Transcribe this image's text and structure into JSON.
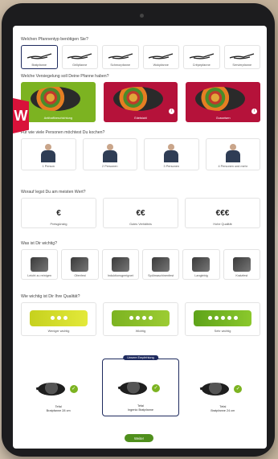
{
  "badge": {
    "text": "W"
  },
  "q1": {
    "title": "Welchen Pfannentyp benötigen Sie?",
    "options": [
      {
        "label": "Bratpfanne",
        "selected": true
      },
      {
        "label": "Grillpfanne",
        "selected": false
      },
      {
        "label": "Schmorpfanne",
        "selected": false
      },
      {
        "label": "Wokpfanne",
        "selected": false
      },
      {
        "label": "Crêpepfanne",
        "selected": false
      },
      {
        "label": "Servierpfanne",
        "selected": false
      }
    ]
  },
  "q2": {
    "title": "Welche Versiegelung soll Deine Pfanne haben?",
    "options": [
      {
        "label": "Antihaftbeschichtung",
        "color": "#7cb321"
      },
      {
        "label": "Edelstahl",
        "color": "#b5123a"
      },
      {
        "label": "Gusseisen",
        "color": "#b5123a"
      }
    ]
  },
  "q3": {
    "title": "Für wie viele Personen möchtest Du kochen?",
    "options": [
      {
        "label": "1 Person"
      },
      {
        "label": "2 Personen"
      },
      {
        "label": "3 Personen"
      },
      {
        "label": "4 Personen und mehr"
      }
    ]
  },
  "q4": {
    "title": "Worauf legst Du am meisten Wert?",
    "options": [
      {
        "symbol": "€",
        "label": "Preisgünstig"
      },
      {
        "symbol": "€€",
        "label": "Gutes Verhältnis"
      },
      {
        "symbol": "€€€",
        "label": "Hohe Qualität"
      }
    ]
  },
  "q5": {
    "title": "Was ist Dir wichtig?",
    "options": [
      {
        "label": "Leicht zu reinigen"
      },
      {
        "label": "Ofenfest"
      },
      {
        "label": "Induktionsgeeignet"
      },
      {
        "label": "Spülmaschinenfest"
      },
      {
        "label": "Langlebig"
      },
      {
        "label": "Kratzfest"
      }
    ]
  },
  "q6": {
    "title": "Wie wichtig ist Dir Ihre Qualität?",
    "options": [
      {
        "label": "Weniger wichtig"
      },
      {
        "label": "Wichtig"
      },
      {
        "label": "Sehr wichtig"
      }
    ]
  },
  "results": {
    "best_tag": "Unsere Empfehlung",
    "items": [
      {
        "brand": "Tefal",
        "name": "Bratpfanne 28 cm"
      },
      {
        "brand": "Tefal",
        "name": "Ingenio Bratpfanne"
      },
      {
        "brand": "Tefal",
        "name": "Bratpfanne 24 cm"
      }
    ]
  },
  "cta": {
    "label": "Weiter"
  }
}
